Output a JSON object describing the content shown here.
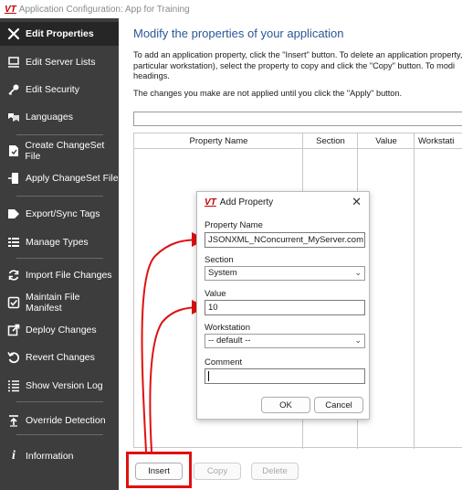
{
  "window": {
    "logo_text": "VT",
    "title": "Application Configuration: App for Training"
  },
  "sidebar": {
    "items": [
      {
        "label": "Edit Properties",
        "icon": "tools-icon"
      },
      {
        "label": "Edit Server Lists",
        "icon": "server-icon"
      },
      {
        "label": "Edit Security",
        "icon": "key-icon"
      },
      {
        "label": "Languages",
        "icon": "languages-icon"
      },
      {
        "label": "Create ChangeSet File",
        "icon": "create-changeset-icon"
      },
      {
        "label": "Apply ChangeSet File",
        "icon": "apply-changeset-icon"
      },
      {
        "label": "Export/Sync Tags",
        "icon": "tag-icon"
      },
      {
        "label": "Manage Types",
        "icon": "types-icon"
      },
      {
        "label": "Import File Changes",
        "icon": "sync-icon"
      },
      {
        "label": "Maintain File Manifest",
        "icon": "checkbox-icon"
      },
      {
        "label": "Deploy Changes",
        "icon": "deploy-icon"
      },
      {
        "label": "Revert Changes",
        "icon": "revert-icon"
      },
      {
        "label": "Show Version Log",
        "icon": "log-icon"
      },
      {
        "label": "Override Detection",
        "icon": "override-icon"
      },
      {
        "label": "Information",
        "icon": "info-icon"
      }
    ]
  },
  "main": {
    "heading": "Modify the properties of your application",
    "description": "To add an application property, click the \"Insert\" button. To delete an application property, a particular workstation), select the property to copy and click the \"Copy\" button. To modi headings.",
    "note": "The changes you make are not applied until you click the \"Apply\" button.",
    "filter_value": "",
    "columns": [
      "Property Name",
      "Section",
      "Value",
      "Workstati"
    ],
    "buttons": {
      "insert": "Insert",
      "copy": "Copy",
      "delete": "Delete"
    }
  },
  "dialog": {
    "logo_text": "VT",
    "title": "Add Property",
    "close": "✕",
    "property_name_label": "Property Name",
    "property_name_value": "JSONXML_NConcurrent_MyServer.com",
    "section_label": "Section",
    "section_value": "System",
    "value_label": "Value",
    "value_value": "10",
    "workstation_label": "Workstation",
    "workstation_value": "-- default --",
    "comment_label": "Comment",
    "comment_value": "",
    "ok": "OK",
    "cancel": "Cancel"
  },
  "colors": {
    "sidebar_bg": "#3d3d3d",
    "sidebar_active": "#262626",
    "heading": "#2b5797",
    "highlight": "#e01010",
    "logo": "#c00000"
  }
}
